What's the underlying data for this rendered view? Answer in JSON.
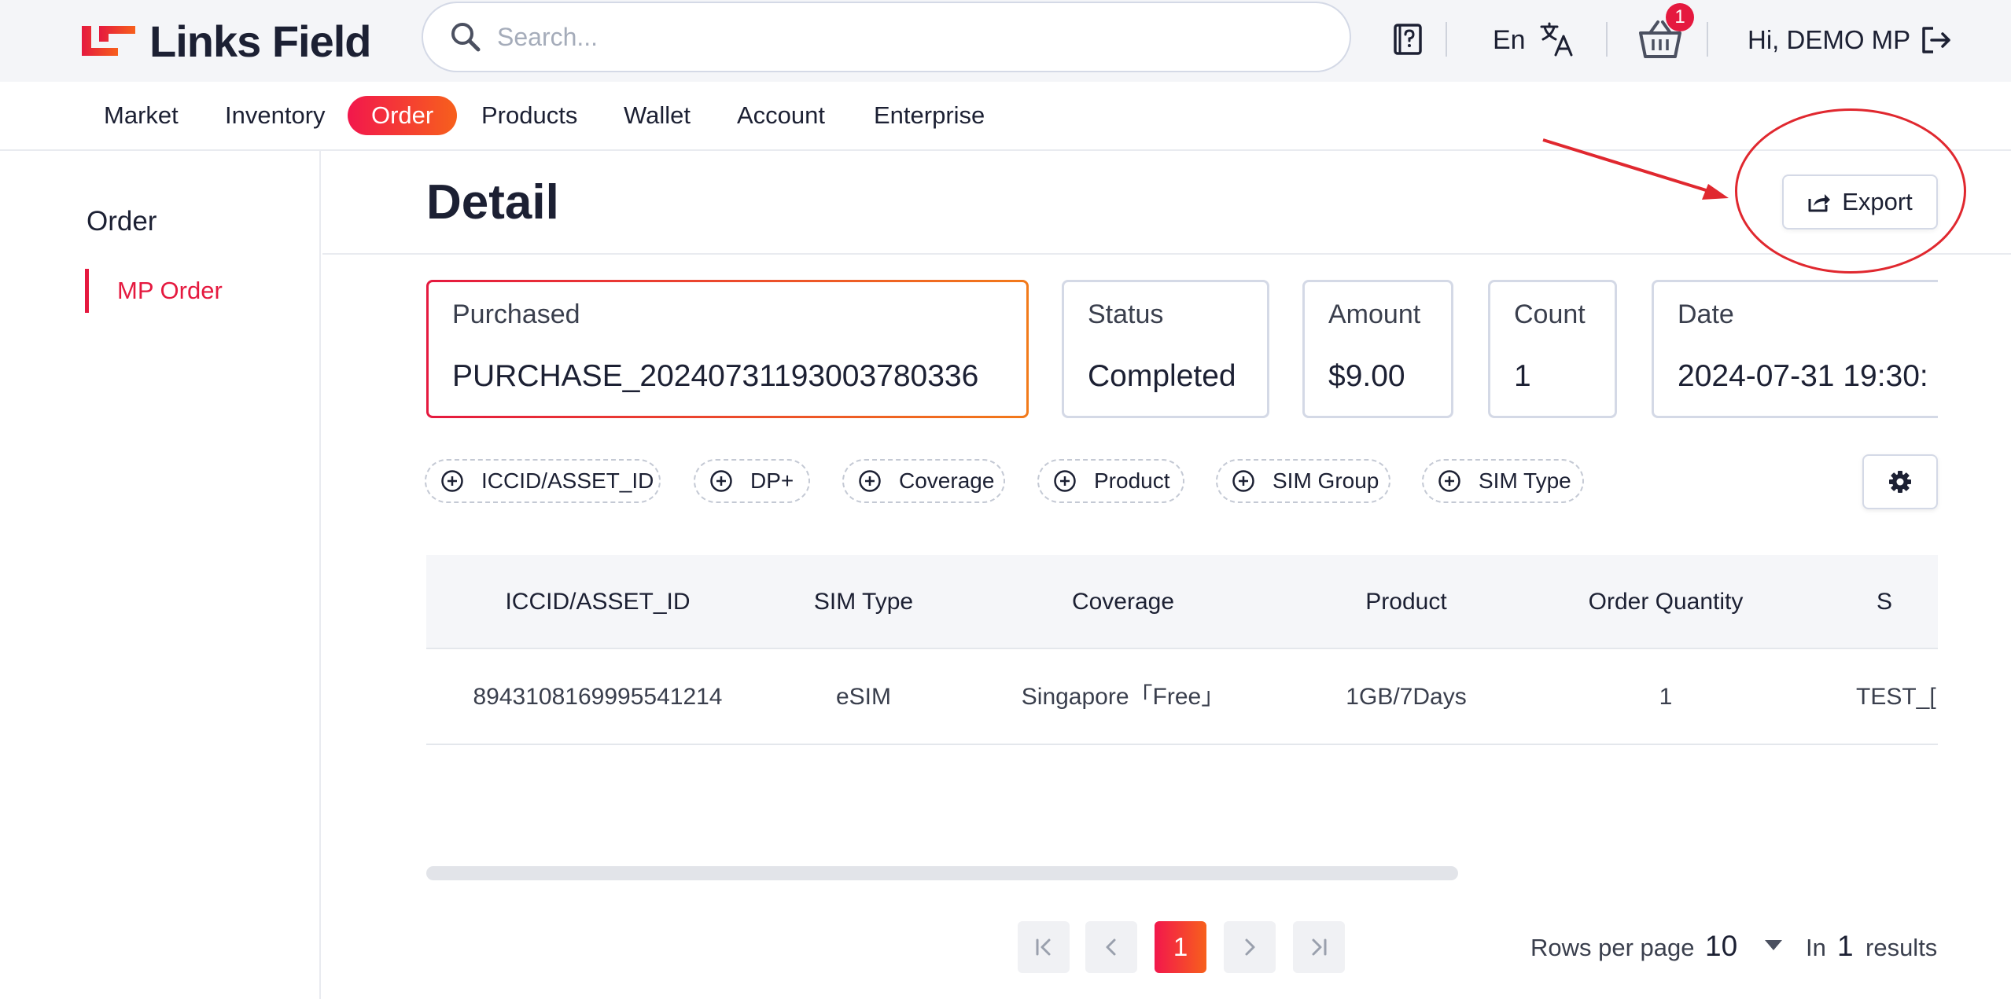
{
  "brand": {
    "name": "Links Field",
    "accent": "#e5193f",
    "accent_end": "#f7601c"
  },
  "search": {
    "placeholder": "Search..."
  },
  "header": {
    "language": "En",
    "cart_count": "1",
    "greeting": "Hi, DEMO MP"
  },
  "nav": {
    "items": [
      {
        "label": "Market"
      },
      {
        "label": "Inventory"
      },
      {
        "label": "Order",
        "active": true
      },
      {
        "label": "Products"
      },
      {
        "label": "Wallet"
      },
      {
        "label": "Account"
      },
      {
        "label": "Enterprise"
      }
    ]
  },
  "sidebar": {
    "title": "Order",
    "items": [
      {
        "label": "MP Order",
        "active": true
      }
    ]
  },
  "page": {
    "title": "Detail",
    "export_label": "Export"
  },
  "summary": {
    "cards": [
      {
        "label": "Purchased",
        "value": "PURCHASE_20240731193003780336"
      },
      {
        "label": "Status",
        "value": "Completed"
      },
      {
        "label": "Amount",
        "value": "$9.00"
      },
      {
        "label": "Count",
        "value": "1"
      },
      {
        "label": "Date",
        "value": "2024-07-31 19:30:"
      }
    ]
  },
  "filters": {
    "chips": [
      {
        "label": "ICCID/ASSET_ID"
      },
      {
        "label": "DP+"
      },
      {
        "label": "Coverage"
      },
      {
        "label": "Product"
      },
      {
        "label": "SIM Group"
      },
      {
        "label": "SIM Type"
      }
    ]
  },
  "table": {
    "columns": [
      "ICCID/ASSET_ID",
      "SIM Type",
      "Coverage",
      "Product",
      "Order Quantity",
      "S"
    ],
    "rows": [
      [
        "8943108169995541214",
        "eSIM",
        "Singapore「Free」",
        "1GB/7Days",
        "1",
        "TEST_["
      ]
    ]
  },
  "pagination": {
    "current_page": "1",
    "rows_per_page_label": "Rows per page",
    "rows_per_page": "10",
    "in_label": "In",
    "total": "1",
    "results_label": "results"
  }
}
